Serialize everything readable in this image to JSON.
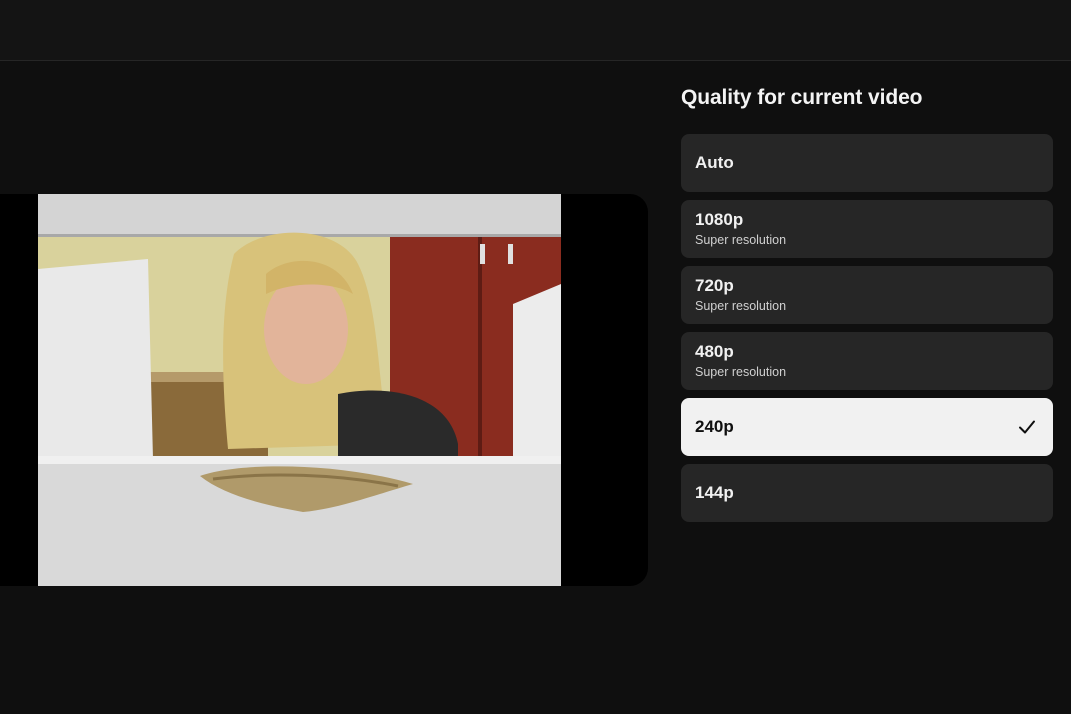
{
  "panel": {
    "title": "Quality for current video",
    "options": [
      {
        "label": "Auto",
        "sub": "",
        "selected": false
      },
      {
        "label": "1080p",
        "sub": "Super resolution",
        "selected": false
      },
      {
        "label": "720p",
        "sub": "Super resolution",
        "selected": false
      },
      {
        "label": "480p",
        "sub": "Super resolution",
        "selected": false
      },
      {
        "label": "240p",
        "sub": "",
        "selected": true
      },
      {
        "label": "144p",
        "sub": "",
        "selected": false
      }
    ],
    "selected_icon": "checkmark-icon"
  },
  "colors": {
    "background": "#0f0f0f",
    "option_bg": "#262626",
    "selected_bg": "#f1f1f1"
  }
}
